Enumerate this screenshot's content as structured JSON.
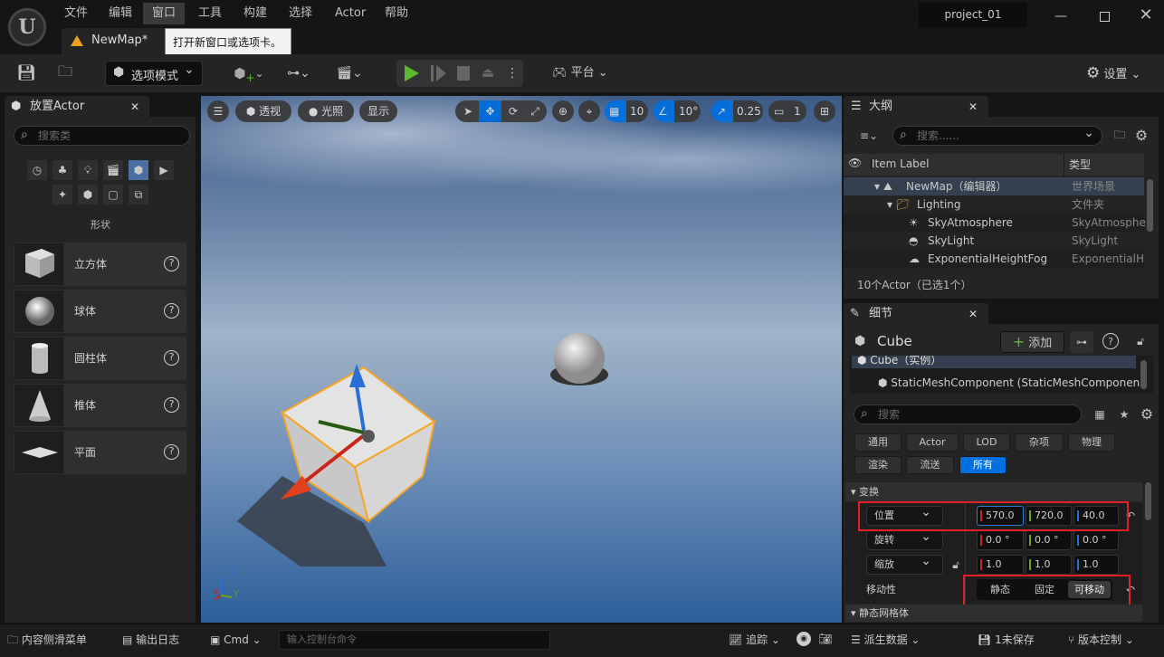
{
  "titlebar": {
    "menus": [
      "文件",
      "编辑",
      "窗口",
      "工具",
      "构建",
      "选择",
      "Actor",
      "帮助"
    ],
    "active_menu": "窗口",
    "map_tab": "NewMap*",
    "tooltip": "打开新窗口或选项卡。",
    "project": "project_01"
  },
  "toolbar": {
    "mode_label": "选项模式",
    "platform_label": "平台",
    "settings_label": "设置"
  },
  "place_actor": {
    "tab_label": "放置Actor",
    "search_placeholder": "搜索类",
    "category_label": "形状",
    "items": [
      {
        "label": "立方体"
      },
      {
        "label": "球体"
      },
      {
        "label": "圆柱体"
      },
      {
        "label": "椎体"
      },
      {
        "label": "平面"
      }
    ]
  },
  "viewport": {
    "perspective": "透视",
    "lighting": "光照",
    "show": "显示",
    "grid_snap": "10",
    "rotation_snap": "10°",
    "scale_snap": "0.25",
    "camera_speed": "1",
    "axis_labels": [
      "Z",
      "X",
      "Y"
    ]
  },
  "outliner": {
    "tab_label": "大纲",
    "search_placeholder": "搜索......",
    "col_label": "Item Label",
    "col_type": "类型",
    "rows": [
      {
        "label": "NewMap（编辑器）",
        "type": "世界场景"
      },
      {
        "label": "Lighting",
        "type": "文件夹"
      },
      {
        "label": "SkyAtmosphere",
        "type": "SkyAtmosphe"
      },
      {
        "label": "SkyLight",
        "type": "SkyLight"
      },
      {
        "label": "ExponentialHeightFog",
        "type": "ExponentialHe"
      }
    ],
    "footer": "10个Actor（已选1个）"
  },
  "details": {
    "tab_label": "细节",
    "actor_name": "Cube",
    "add_label": "添加",
    "components": [
      "Cube（实例）",
      "StaticMeshComponent (StaticMeshComponen"
    ],
    "search_placeholder": "搜索",
    "filters": [
      "通用",
      "Actor",
      "LOD",
      "杂项",
      "物理",
      "渲染",
      "流送",
      "所有"
    ],
    "active_filter": "所有",
    "section_transform": "变换",
    "location": {
      "label": "位置",
      "x": "570.0",
      "y": "720.0",
      "z": "40.0"
    },
    "rotation": {
      "label": "旋转",
      "x": "0.0 °",
      "y": "0.0 °",
      "z": "0.0 °"
    },
    "scale": {
      "label": "缩放",
      "x": "1.0",
      "y": "1.0",
      "z": "1.0"
    },
    "mobility": {
      "label": "移动性",
      "options": [
        "静态",
        "固定",
        "可移动"
      ],
      "selected": "可移动"
    },
    "section_mesh": "静态网格体"
  },
  "statusbar": {
    "content_drawer": "内容侧滑菜单",
    "output_log": "输出日志",
    "cmd": "Cmd",
    "console_placeholder": "输入控制台命令",
    "trace": "追踪",
    "derived_data": "派生数据",
    "unsaved": "1未保存",
    "source_control": "版本控制"
  },
  "colors": {
    "accent": "#0070e0",
    "highlight_box": "#e0202a",
    "play": "#5cb82c",
    "x": "#c8261b",
    "y": "#6aa51c",
    "z": "#2a6fd6"
  }
}
